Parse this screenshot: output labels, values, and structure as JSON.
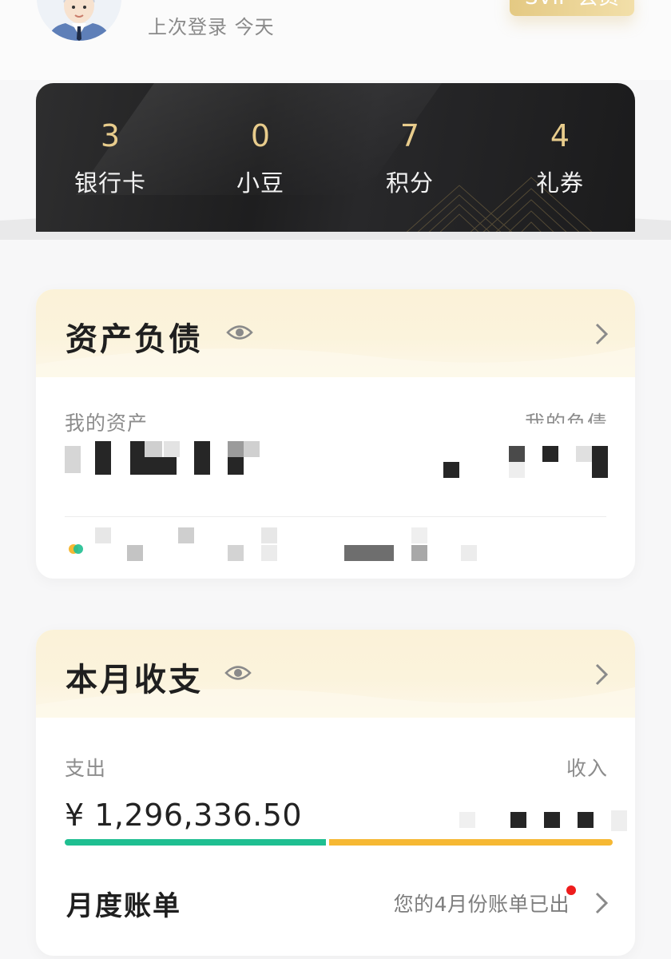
{
  "header": {
    "last_login": "上次登录 今天",
    "level_badge": "SVIP 会员"
  },
  "stats": [
    {
      "value": "3",
      "label": "银行卡"
    },
    {
      "value": "0",
      "label": "小豆"
    },
    {
      "value": "7",
      "label": "积分"
    },
    {
      "value": "4",
      "label": "礼券"
    }
  ],
  "assets_card": {
    "title": "资产负债",
    "my_assets_label": "我的资产",
    "my_liabilities_label": "我的负债"
  },
  "income_card": {
    "title": "本月收支",
    "expense_label": "支出",
    "income_label": "收入",
    "expense_amount": "¥ 1,296,336.50",
    "expense_share": 0.48,
    "monthly_bill_title": "月度账单",
    "monthly_bill_note": "您的4月份账单已出"
  },
  "colors": {
    "gold": "#e8cc8c",
    "expense_bar": "#1fbf91",
    "income_bar": "#f6b833",
    "notification_dot": "#ee1c1c"
  },
  "icons": {
    "eye": "eye-icon",
    "chevron": "chevron-right-icon",
    "avatar": "user-avatar"
  }
}
